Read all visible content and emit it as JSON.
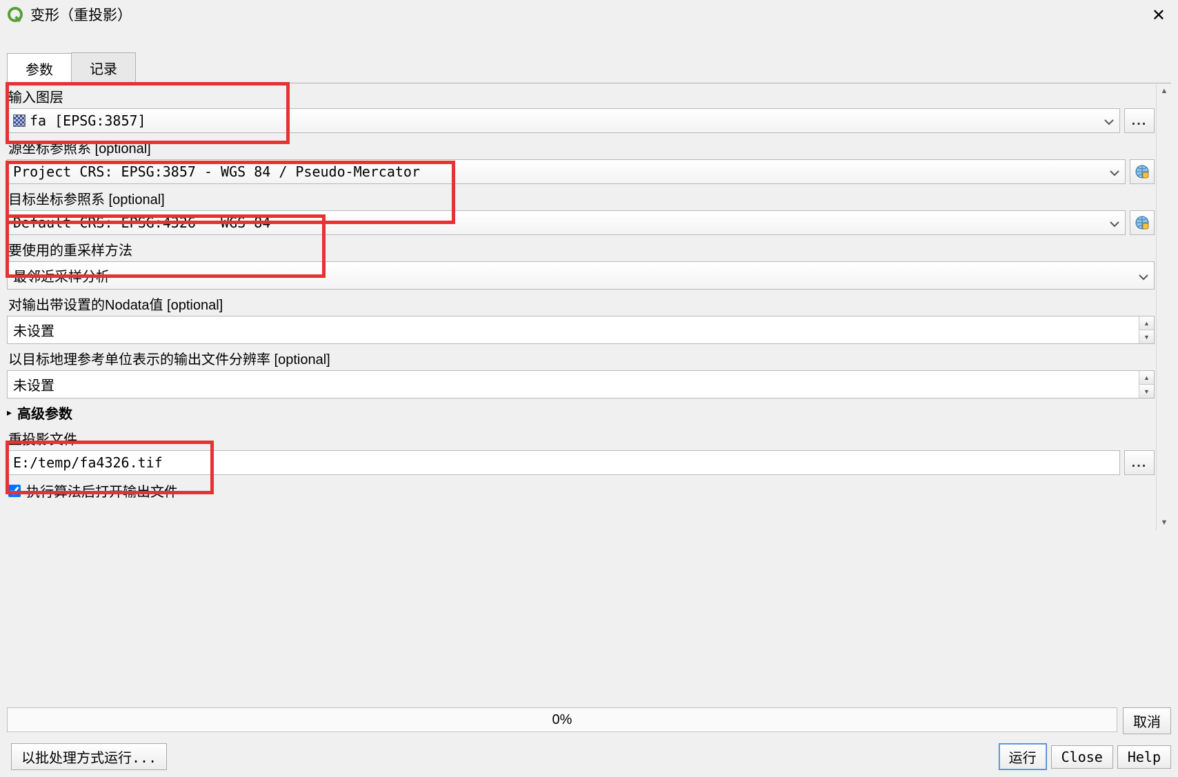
{
  "window": {
    "title": "变形（重投影）"
  },
  "tabs": {
    "params": "参数",
    "log": "记录"
  },
  "fields": {
    "input_layer_label": "输入图层",
    "input_layer_value": "fa [EPSG:3857]",
    "source_crs_label": "源坐标参照系 [optional]",
    "source_crs_value": "Project CRS: EPSG:3857 - WGS 84 / Pseudo-Mercator",
    "target_crs_label": "目标坐标参照系 [optional]",
    "target_crs_value": "Default CRS: EPSG:4326 - WGS 84",
    "resample_label": "要使用的重采样方法",
    "resample_value": "最邻近采样分析",
    "nodata_label": "对输出带设置的Nodata值 [optional]",
    "nodata_value": "未设置",
    "resolution_label": "以目标地理参考单位表示的输出文件分辨率 [optional]",
    "resolution_value": "未设置",
    "advanced_label": "高级参数",
    "output_label": "重投影文件",
    "output_value": "E:/temp/fa4326.tif",
    "open_after_label": "执行算法后打开输出文件"
  },
  "progress": {
    "text": "0%"
  },
  "buttons": {
    "cancel": "取消",
    "batch": "以批处理方式运行...",
    "run": "运行",
    "close": "Close",
    "help": "Help",
    "ellipsis": "..."
  }
}
